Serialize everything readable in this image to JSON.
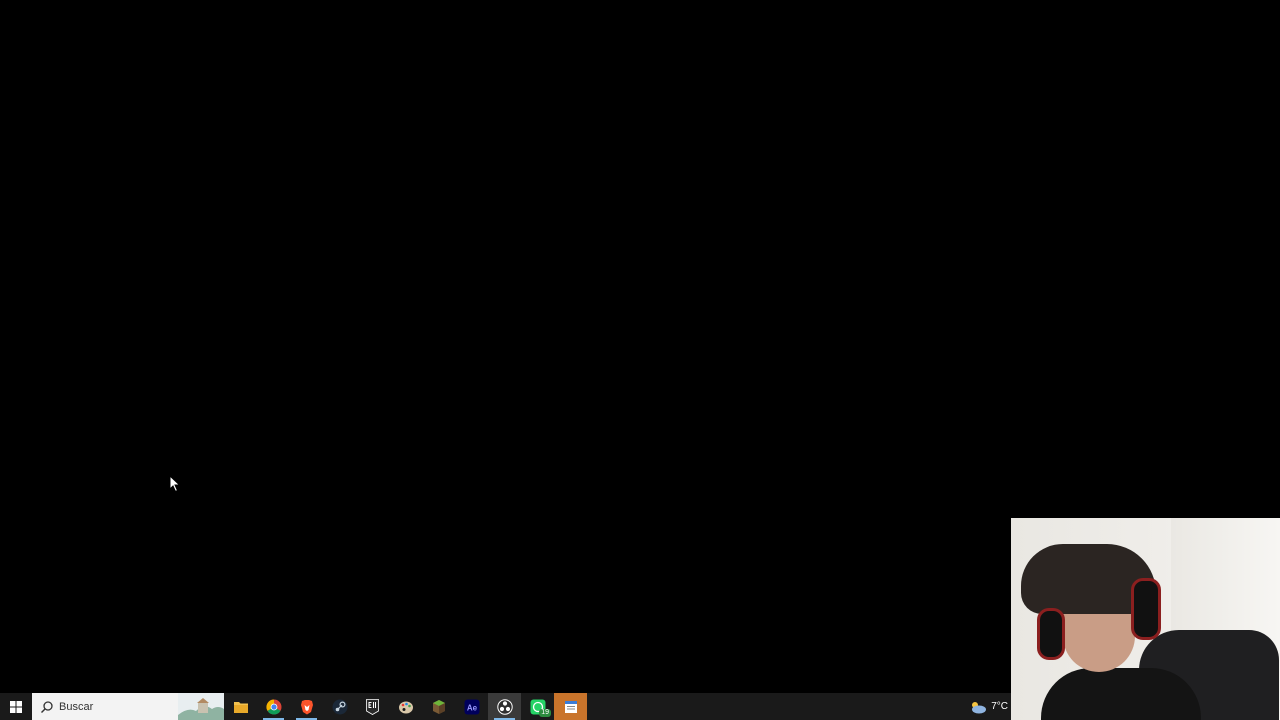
{
  "taskbar": {
    "search_placeholder": "Buscar",
    "apps": [
      {
        "name": "file-explorer",
        "running": false
      },
      {
        "name": "chrome",
        "running": true
      },
      {
        "name": "brave",
        "running": true
      },
      {
        "name": "steam",
        "running": false
      },
      {
        "name": "epic-games",
        "running": false
      },
      {
        "name": "paint",
        "running": false
      },
      {
        "name": "minecraft-launcher",
        "running": false
      },
      {
        "name": "after-effects",
        "running": false
      },
      {
        "name": "obs",
        "running": true
      },
      {
        "name": "whatsapp",
        "running": false,
        "badge": "19"
      },
      {
        "name": "notepad",
        "running": false
      }
    ],
    "tray": {
      "weather_icon": "cloud-sun-icon",
      "temperature": "7°C"
    }
  },
  "colors": {
    "taskbar_bg": "#1a1a1a",
    "desktop_bg": "#000000",
    "running_indicator": "#7fb8e8",
    "highlight_app": "#c9742b"
  }
}
